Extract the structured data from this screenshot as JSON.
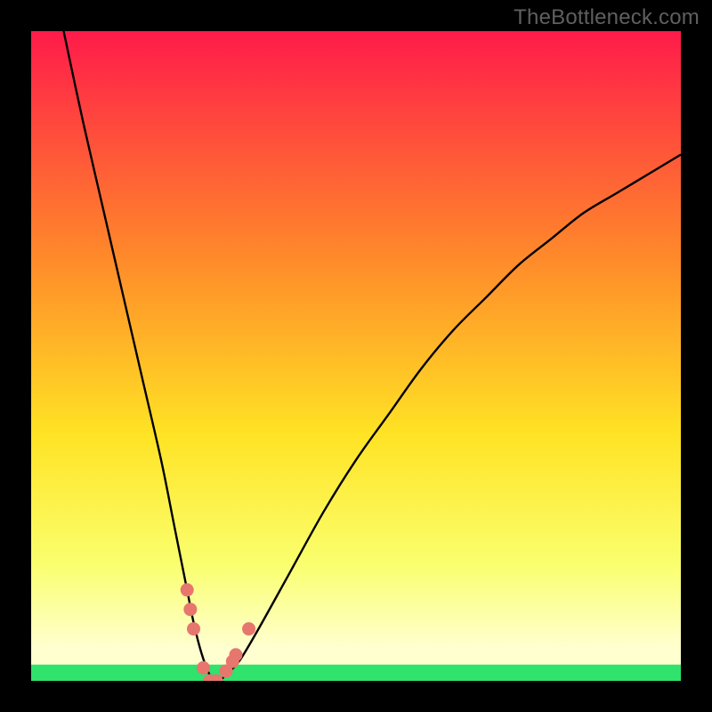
{
  "watermark": "TheBottleneck.com",
  "colors": {
    "bg_black": "#000000",
    "curve": "#000000",
    "dot": "#e7766e",
    "green_band": "#2fe36c",
    "grad_top": "#ff1b4a",
    "grad_mid1": "#ff8a2a",
    "grad_mid2": "#ffe324",
    "grad_mid3": "#faff6e",
    "grad_bottom": "#ffffd0"
  },
  "chart_data": {
    "type": "line",
    "title": "",
    "xlabel": "",
    "ylabel": "",
    "xlim": [
      0,
      100
    ],
    "ylim": [
      0,
      100
    ],
    "series": [
      {
        "name": "bottleneck-curve",
        "x": [
          5,
          8,
          11,
          14,
          17,
          20,
          22,
          24,
          25,
          26,
          27,
          28,
          29,
          30,
          32,
          35,
          40,
          45,
          50,
          55,
          60,
          65,
          70,
          75,
          80,
          85,
          90,
          95,
          100
        ],
        "y": [
          100,
          86,
          73,
          60,
          47,
          34,
          24,
          14,
          9,
          5,
          2,
          0,
          0,
          1,
          3,
          8,
          17,
          26,
          34,
          41,
          48,
          54,
          59,
          64,
          68,
          72,
          75,
          78,
          81
        ]
      }
    ],
    "markers": [
      {
        "x": 24.0,
        "y": 14
      },
      {
        "x": 24.5,
        "y": 11
      },
      {
        "x": 25.0,
        "y": 8
      },
      {
        "x": 26.5,
        "y": 2
      },
      {
        "x": 27.5,
        "y": 0
      },
      {
        "x": 28.5,
        "y": 0
      },
      {
        "x": 30.0,
        "y": 1.5
      },
      {
        "x": 31.0,
        "y": 3
      },
      {
        "x": 31.5,
        "y": 4
      },
      {
        "x": 33.5,
        "y": 8
      }
    ],
    "green_band_y": 2.5
  }
}
